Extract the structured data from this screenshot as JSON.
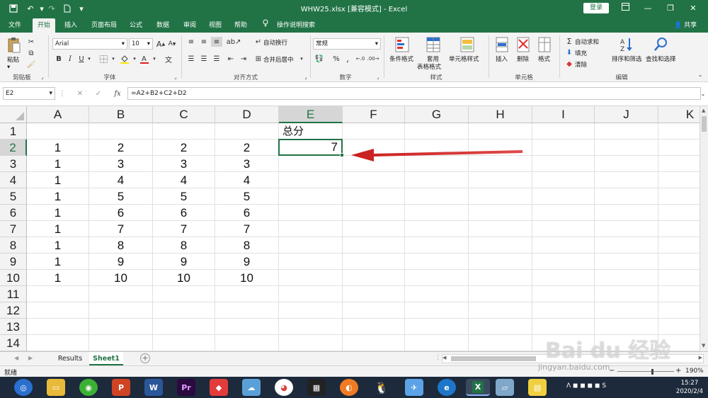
{
  "window": {
    "title": "WHW25.xlsx [兼容模式] - Excel",
    "signin": "登录",
    "quick_access": [
      "save-icon",
      "undo-icon",
      "redo-icon",
      "new-file-icon",
      "customize-icon"
    ]
  },
  "ribbon_tabs": [
    {
      "label": "文件"
    },
    {
      "label": "开始"
    },
    {
      "label": "插入"
    },
    {
      "label": "页面布局"
    },
    {
      "label": "公式"
    },
    {
      "label": "数据"
    },
    {
      "label": "审阅"
    },
    {
      "label": "视图"
    },
    {
      "label": "帮助"
    },
    {
      "label": "操作说明搜索"
    }
  ],
  "active_tab": "开始",
  "share": "共享",
  "ribbon": {
    "clipboard": {
      "paste": "粘贴",
      "label": "剪贴板"
    },
    "font": {
      "name": "Arial",
      "size": "10",
      "bold": "B",
      "italic": "I",
      "underline": "U",
      "label": "字体"
    },
    "alignment": {
      "wrap": "自动换行",
      "merge": "合并后居中",
      "label": "对齐方式"
    },
    "number": {
      "format": "常规",
      "label": "数字"
    },
    "styles": {
      "conditional": "条件格式",
      "table_line1": "套用",
      "table_line2": "表格格式",
      "cell_styles": "单元格样式",
      "label": "样式"
    },
    "cells": {
      "insert": "插入",
      "delete": "删除",
      "format": "格式",
      "label": "单元格"
    },
    "editing": {
      "autosum": "自动求和",
      "fill": "填充",
      "clear": "清除",
      "sort": "排序和筛选",
      "find": "查找和选择",
      "label": "编辑"
    }
  },
  "formula_bar": {
    "name_box": "E2",
    "fx": "fx",
    "formula": "=A2+B2+C2+D2"
  },
  "columns": [
    "A",
    "B",
    "C",
    "D",
    "E",
    "F",
    "G",
    "H",
    "I",
    "J",
    "K"
  ],
  "rows": [
    "1",
    "2",
    "3",
    "4",
    "5",
    "6",
    "7",
    "8",
    "9",
    "10",
    "11",
    "12",
    "13",
    "14"
  ],
  "cells": [
    {
      "ref": "E1",
      "value": "总分"
    },
    {
      "ref": "A2",
      "value": "1"
    },
    {
      "ref": "B2",
      "value": "2"
    },
    {
      "ref": "C2",
      "value": "2"
    },
    {
      "ref": "D2",
      "value": "2"
    },
    {
      "ref": "E2",
      "value": "7"
    },
    {
      "ref": "A3",
      "value": "1"
    },
    {
      "ref": "B3",
      "value": "3"
    },
    {
      "ref": "C3",
      "value": "3"
    },
    {
      "ref": "D3",
      "value": "3"
    },
    {
      "ref": "A4",
      "value": "1"
    },
    {
      "ref": "B4",
      "value": "4"
    },
    {
      "ref": "C4",
      "value": "4"
    },
    {
      "ref": "D4",
      "value": "4"
    },
    {
      "ref": "A5",
      "value": "1"
    },
    {
      "ref": "B5",
      "value": "5"
    },
    {
      "ref": "C5",
      "value": "5"
    },
    {
      "ref": "D5",
      "value": "5"
    },
    {
      "ref": "A6",
      "value": "1"
    },
    {
      "ref": "B6",
      "value": "6"
    },
    {
      "ref": "C6",
      "value": "6"
    },
    {
      "ref": "D6",
      "value": "6"
    },
    {
      "ref": "A7",
      "value": "1"
    },
    {
      "ref": "B7",
      "value": "7"
    },
    {
      "ref": "C7",
      "value": "7"
    },
    {
      "ref": "D7",
      "value": "7"
    },
    {
      "ref": "A8",
      "value": "1"
    },
    {
      "ref": "B8",
      "value": "8"
    },
    {
      "ref": "C8",
      "value": "8"
    },
    {
      "ref": "D8",
      "value": "8"
    },
    {
      "ref": "A9",
      "value": "1"
    },
    {
      "ref": "B9",
      "value": "9"
    },
    {
      "ref": "C9",
      "value": "9"
    },
    {
      "ref": "D9",
      "value": "9"
    },
    {
      "ref": "A10",
      "value": "1"
    },
    {
      "ref": "B10",
      "value": "10"
    },
    {
      "ref": "C10",
      "value": "10"
    },
    {
      "ref": "D10",
      "value": "10"
    }
  ],
  "active_cell": "E2",
  "annotation_arrow_color": "#d42a2a",
  "sheets": [
    {
      "label": "Results"
    },
    {
      "label": "Sheet1"
    }
  ],
  "active_sheet": "Sheet1",
  "status": {
    "ready": "就绪",
    "zoom": "190%"
  },
  "taskbar": {
    "apps": [
      "browser-icon",
      "file-explorer-icon",
      "wechat-icon",
      "powerpoint-icon",
      "word-icon",
      "premiere-icon",
      "app-icon",
      "app-icon",
      "chrome-icon",
      "media-icon",
      "app-icon",
      "qq-icon",
      "app-icon",
      "ie-icon",
      "excel-icon",
      "app-icon",
      "app-icon"
    ],
    "time": "15:27",
    "date": "2020/2/4"
  },
  "watermark": {
    "text": "Bai du 经验",
    "sub": "jingyan.baidu.com"
  },
  "accent_color": "#217346"
}
